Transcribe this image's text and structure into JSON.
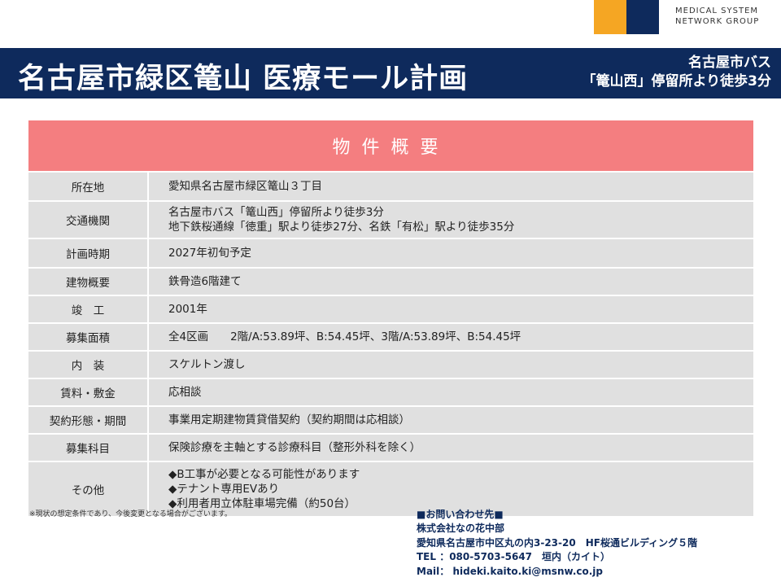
{
  "logo": {
    "line1": "MEDICAL SYSTEM",
    "line2": "NETWORK GROUP",
    "colors": {
      "orange": "#f5a623",
      "navy": "#0e2a5c"
    }
  },
  "header": {
    "title": "名古屋市緑区篭山 医療モール計画",
    "access_line1": "名古屋市バス",
    "access_line2": "「篭山西」停留所より徒歩3分"
  },
  "table": {
    "heading": "物件概要",
    "rows": [
      {
        "label": "所在地",
        "lines": [
          "愛知県名古屋市緑区篭山３丁目"
        ]
      },
      {
        "label": "交通機関",
        "lines": [
          "名古屋市バス「篭山西」停留所より徒歩3分",
          "地下鉄桜通線「徳重」駅より徒歩27分、名鉄「有松」駅より徒歩35分"
        ]
      },
      {
        "label": "計画時期",
        "lines": [
          "2027年初旬予定"
        ]
      },
      {
        "label": "建物概要",
        "lines": [
          "鉄骨造6階建て"
        ]
      },
      {
        "label": "竣　工",
        "lines": [
          "2001年"
        ]
      },
      {
        "label": "募集面積",
        "lines": [
          "全4区画　　2階/A:53.89坪、B:54.45坪、3階/A:53.89坪、B:54.45坪"
        ]
      },
      {
        "label": "内　装",
        "lines": [
          "スケルトン渡し"
        ]
      },
      {
        "label": "賃料・敷金",
        "lines": [
          "応相談"
        ]
      },
      {
        "label": "契約形態・期間",
        "lines": [
          "事業用定期建物賃貸借契約（契約期間は応相談）"
        ]
      },
      {
        "label": "募集科目",
        "lines": [
          "保険診療を主軸とする診療科目（整形外科を除く）"
        ]
      },
      {
        "label": "その他",
        "lines": [
          "◆B工事が必要となる可能性があります",
          "◆テナント専用EVあり",
          "◆利用者用立体駐車場完備（約50台）"
        ]
      }
    ]
  },
  "note": "※現状の想定条件であり、今後変更となる場合がございます。",
  "contact": {
    "heading": "■お問い合わせ先■",
    "company": "株式会社なの花中部",
    "address": "愛知県名古屋市中区丸の内3-23-20　HF桜通ビルディング５階",
    "tel": "TEL ：080-5703-5647　垣内（カイト）",
    "mail": "Mail： hideki.kaito.ki@msnw.co.jp"
  }
}
